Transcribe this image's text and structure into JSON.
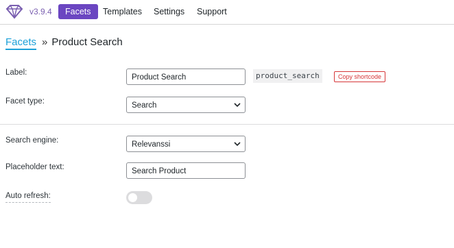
{
  "header": {
    "version": "v3.9.4",
    "nav": [
      "Facets",
      "Templates",
      "Settings",
      "Support"
    ]
  },
  "breadcrumb": {
    "parent": "Facets",
    "separator": "»",
    "current": "Product Search"
  },
  "form": {
    "label": {
      "label": "Label:",
      "value": "Product Search",
      "shortcode": "product_search",
      "copy_button": "Copy shortcode"
    },
    "facet_type": {
      "label": "Facet type:",
      "value": "Search"
    },
    "search_engine": {
      "label": "Search engine:",
      "value": "Relevanssi"
    },
    "placeholder_text": {
      "label": "Placeholder text:",
      "value": "Search Product"
    },
    "auto_refresh": {
      "label": "Auto refresh:",
      "enabled": false
    }
  },
  "colors": {
    "accent": "#6b46c1",
    "link": "#1ba0d8",
    "danger": "#d63638"
  }
}
